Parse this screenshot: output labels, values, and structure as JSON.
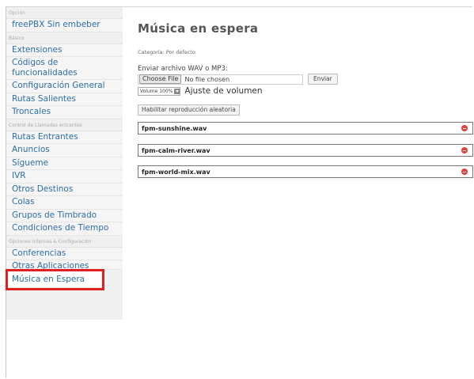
{
  "sidebar": {
    "sections": [
      {
        "label": "Opción",
        "items": [
          "freePBX Sin embeber"
        ]
      },
      {
        "label": "Básico",
        "items": [
          "Extensiones",
          "Códigos de funcionalidades",
          "Configuración General",
          "Rutas Salientes",
          "Troncales"
        ]
      },
      {
        "label": "Control de Llamadas entrantes",
        "items": [
          "Rutas Entrantes",
          "Anuncios",
          "Sígueme",
          "IVR",
          "Otros Destinos",
          "Colas",
          "Grupos de Timbrado",
          "Condiciones de Tiempo"
        ]
      },
      {
        "label": "Opciones Internas & Configuración",
        "items": [
          "Conferencias",
          "Otras Aplicaciones",
          "Música en Espera"
        ]
      }
    ],
    "active_item": "Música en Espera"
  },
  "main": {
    "title": "Música en espera",
    "category": "Categoría: Por defecto",
    "upload_label": "Enviar archivo WAV o MP3:",
    "choose_file_label": "Choose File",
    "no_file_text": "No file chosen",
    "send_button": "Enviar",
    "volume_value": "Volume 100%",
    "volume_label": "Ajuste de volumen",
    "random_button": "Habilitar reproducción aleatoria",
    "files": [
      "fpm-sunshine.wav",
      "fpm-calm-river.wav",
      "fpm-world-mix.wav"
    ]
  },
  "colors": {
    "link": "#2e6ea7",
    "highlight": "#e02020",
    "delete": "#e0403a"
  }
}
